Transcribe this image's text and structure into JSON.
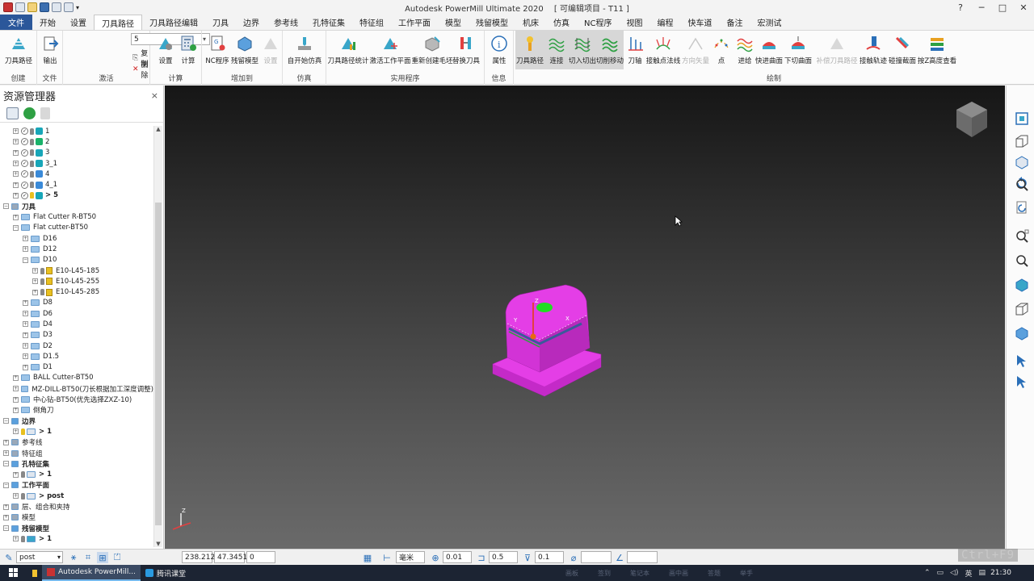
{
  "window": {
    "title": "Autodesk PowerMill Ultimate 2020",
    "project": "[ 可编辑项目 - T11 ]",
    "help_icon": "help-icon",
    "controls": [
      "─",
      "□",
      "✕"
    ]
  },
  "menu": [
    "文件",
    "开始",
    "设置",
    "刀具路径",
    "刀具路径编辑",
    "刀具",
    "边界",
    "参考线",
    "孔特征集",
    "特征组",
    "工作平面",
    "模型",
    "残留模型",
    "机床",
    "仿真",
    "NC程序",
    "视图",
    "编程",
    "快车道",
    "备注",
    "宏测试"
  ],
  "ribbon": {
    "groups": {
      "create": "创建",
      "file": "文件",
      "activate": "激活",
      "calc": "计算",
      "add_to": "增加到",
      "simulate": "仿真",
      "utilities": "实用程序",
      "info": "信息",
      "draw": "绘制"
    },
    "buttons": {
      "toolpath": "刀具路径",
      "export": "输出",
      "settings": "设置",
      "calculate": "计算",
      "nc_program": "NC程序",
      "stock_model": "残留模型",
      "settings2": "设置",
      "sim_start": "自开始仿真",
      "tp_stats": "刀具路径统计",
      "activate_wp": "激活工作平面",
      "recreate_block": "重新创建毛坯",
      "replace_tool": "替换刀具",
      "properties": "属性",
      "draw_toolpath": "刀具路径",
      "links": "连接",
      "lead_in_out": "切入切出",
      "cut_moves": "切削移动",
      "tool_axis": "刀轴",
      "contact_normals": "接触点法线",
      "direction_vec": "方向矢量",
      "points": "点",
      "feeds": "进给",
      "rapid_surface": "快进曲面",
      "plunge_surface": "下切曲面",
      "comp_tp": "补偿刀具路径",
      "contact_track": "接触轨迹",
      "collision_zone": "碰撞截面",
      "z_height": "按Z高度查看"
    },
    "active_selector": "5",
    "copy_label": "复制",
    "delete_label": "删除"
  },
  "explorer": {
    "title": "资源管理器",
    "rows": [
      {
        "indent": 1,
        "kind": "tp",
        "text": "1"
      },
      {
        "indent": 1,
        "kind": "tp2",
        "text": "2"
      },
      {
        "indent": 1,
        "kind": "tp",
        "text": "3"
      },
      {
        "indent": 1,
        "kind": "tp",
        "text": "3_1"
      },
      {
        "indent": 1,
        "kind": "tp3",
        "text": "4"
      },
      {
        "indent": 1,
        "kind": "tp3",
        "text": "4_1"
      },
      {
        "indent": 1,
        "kind": "tpa",
        "text": "> 5"
      },
      {
        "indent": 0,
        "kind": "root",
        "text": "刀具"
      },
      {
        "indent": 1,
        "kind": "folder",
        "text": "Flat Cutter R-BT50"
      },
      {
        "indent": 1,
        "kind": "folderopen",
        "text": "Flat cutter-BT50"
      },
      {
        "indent": 2,
        "kind": "folder",
        "text": "D16"
      },
      {
        "indent": 2,
        "kind": "folder",
        "text": "D12"
      },
      {
        "indent": 2,
        "kind": "folderopen",
        "text": "D10"
      },
      {
        "indent": 3,
        "kind": "tool",
        "text": "E10-L45-185"
      },
      {
        "indent": 3,
        "kind": "tool",
        "text": "E10-L45-255"
      },
      {
        "indent": 3,
        "kind": "tool",
        "text": "E10-L45-285"
      },
      {
        "indent": 2,
        "kind": "folder",
        "text": "D8"
      },
      {
        "indent": 2,
        "kind": "folder",
        "text": "D6"
      },
      {
        "indent": 2,
        "kind": "folder",
        "text": "D4"
      },
      {
        "indent": 2,
        "kind": "folder",
        "text": "D3"
      },
      {
        "indent": 2,
        "kind": "folder",
        "text": "D2"
      },
      {
        "indent": 2,
        "kind": "folder",
        "text": "D1.5"
      },
      {
        "indent": 2,
        "kind": "folder",
        "text": "D1"
      },
      {
        "indent": 1,
        "kind": "folder",
        "text": "BALL Cutter-BT50"
      },
      {
        "indent": 1,
        "kind": "folder",
        "text": "MZ-DILL-BT50(刀长根据加工深度调整)"
      },
      {
        "indent": 1,
        "kind": "folder",
        "text": "中心钻-BT50(优先选择ZXZ-10)"
      },
      {
        "indent": 1,
        "kind": "folder",
        "text": "倒角刀"
      },
      {
        "indent": 0,
        "kind": "rootb",
        "text": "边界"
      },
      {
        "indent": 1,
        "kind": "boundary",
        "text": "> 1"
      },
      {
        "indent": 0,
        "kind": "rootp",
        "text": "参考线"
      },
      {
        "indent": 0,
        "kind": "rootp",
        "text": "特征组"
      },
      {
        "indent": 0,
        "kind": "rootb",
        "text": "孔特征集"
      },
      {
        "indent": 1,
        "kind": "hole",
        "text": "> 1"
      },
      {
        "indent": 0,
        "kind": "rootb",
        "text": "工作平面"
      },
      {
        "indent": 1,
        "kind": "wp",
        "text": "> post"
      },
      {
        "indent": 0,
        "kind": "rootp",
        "text": "层、组合和夹持"
      },
      {
        "indent": 0,
        "kind": "rootp",
        "text": "模型"
      },
      {
        "indent": 0,
        "kind": "rootb",
        "text": "残留模型"
      },
      {
        "indent": 1,
        "kind": "stock",
        "text": "> 1"
      }
    ]
  },
  "viewport": {
    "axis_label": "Z",
    "model_axis_labels": [
      "Z",
      "X",
      "Y"
    ],
    "model_color": "#e43ee6",
    "background_top": "#161616",
    "background_bottom": "#6a6a6a"
  },
  "status": {
    "workplane": "post",
    "x": "238.212",
    "y": "47.3451",
    "z": "0",
    "unit": "毫米",
    "tol": "0.01",
    "stock": "0.5",
    "tool_dia": "0.1"
  },
  "taskbar": {
    "apps": [
      "Autodesk PowerMill...",
      "腾讯课堂"
    ],
    "bg_items": [
      "画板",
      "签到",
      "笔记本",
      "画中画",
      "答题",
      "举手"
    ],
    "ime": "英",
    "time": "21:30"
  },
  "watermark": "Ctrl+F9",
  "colors": {
    "accent": "#2b579a",
    "highlight": "#d7d7d7",
    "model": "#e43ee6"
  }
}
